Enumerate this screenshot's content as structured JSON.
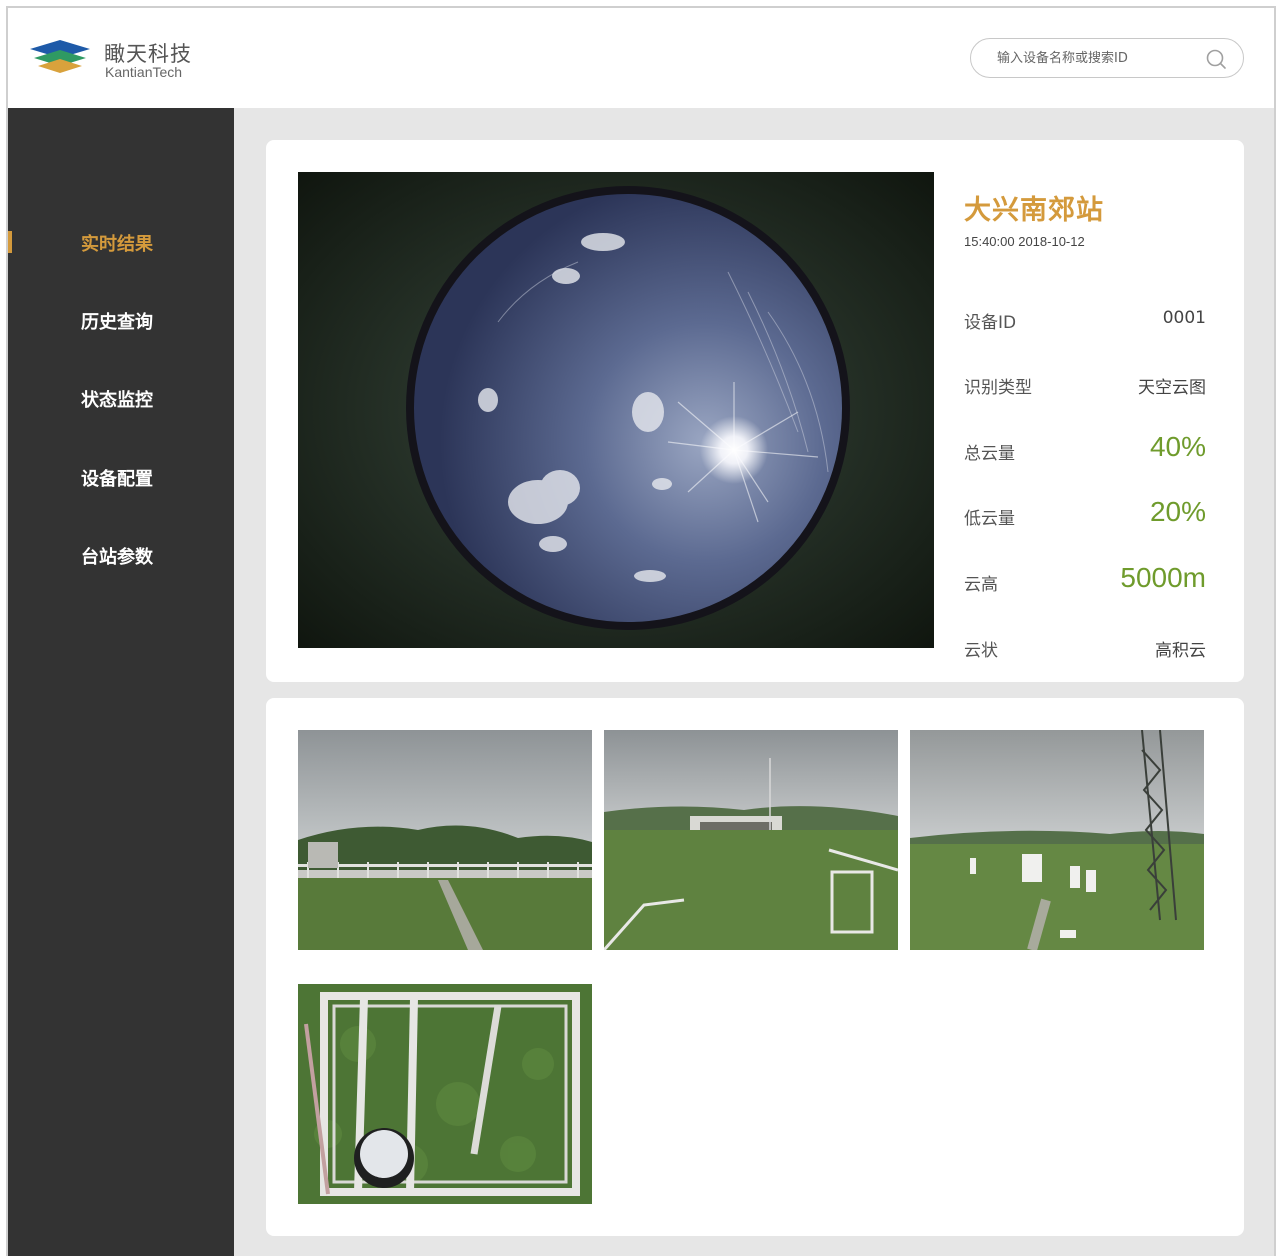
{
  "header": {
    "brand_cn": "瞰天科技",
    "brand_en": "KantianTech",
    "search_placeholder": "输入设备名称或搜索ID",
    "brand_colors": [
      "#1e5aa8",
      "#2f9a63",
      "#d9a23c"
    ]
  },
  "sidebar": {
    "items": [
      {
        "label": "实时结果",
        "active": true
      },
      {
        "label": "历史查询",
        "active": false
      },
      {
        "label": "状态监控",
        "active": false
      },
      {
        "label": "设备配置",
        "active": false
      },
      {
        "label": "台站参数",
        "active": false
      }
    ]
  },
  "station": {
    "name": "大兴南郊站",
    "time": "15:40:00  2018-10-12",
    "fields": [
      {
        "label": "设备ID",
        "value": "0001"
      },
      {
        "label": "识别类型",
        "value": "天空云图"
      },
      {
        "label": "总云量",
        "value": "40%"
      },
      {
        "label": "低云量",
        "value": "20%"
      },
      {
        "label": "云高",
        "value": "5000m"
      },
      {
        "label": "云状",
        "value": "高积云"
      }
    ]
  },
  "colors": {
    "accent": "#d49a3c",
    "value_green": "#6f9b2c",
    "sidebar_bg": "#333333"
  },
  "icons": [
    "search-icon",
    "kantian-logo-icon"
  ]
}
